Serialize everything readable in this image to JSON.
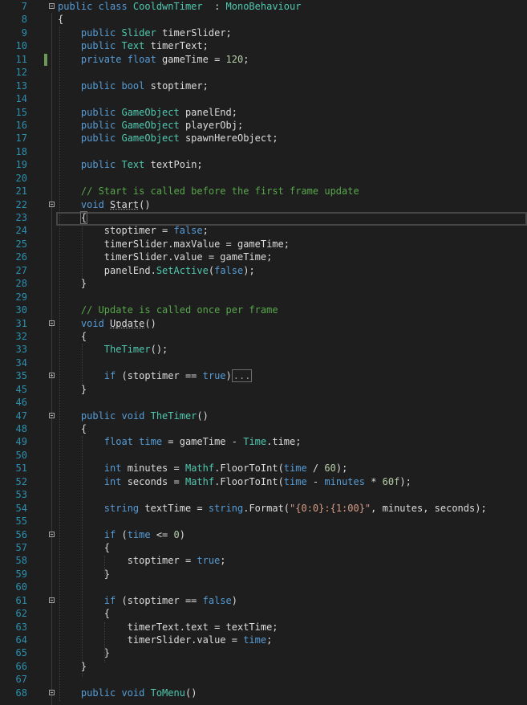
{
  "editor": {
    "fold_icon": "collapse-box-icon",
    "expand_icon": "expand-box-icon",
    "lines": [
      {
        "n": "7",
        "fold": "minus",
        "tokens": [
          [
            "kw",
            "public class "
          ],
          [
            "ty",
            "CooldwnTimer"
          ],
          [
            "",
            "  : "
          ],
          [
            "ty",
            "MonoBehaviour"
          ]
        ]
      },
      {
        "n": "8",
        "fold": "",
        "tokens": [
          [
            "",
            "{"
          ]
        ]
      },
      {
        "n": "9",
        "fold": "",
        "tokens": [
          [
            "",
            "    "
          ],
          [
            "kw",
            "public "
          ],
          [
            "ty",
            "Slider"
          ],
          [
            "",
            " timerSlider;"
          ]
        ]
      },
      {
        "n": "10",
        "fold": "",
        "tokens": [
          [
            "",
            "    "
          ],
          [
            "kw",
            "public "
          ],
          [
            "ty",
            "Text"
          ],
          [
            "",
            " timerText;"
          ]
        ]
      },
      {
        "n": "11",
        "fold": "",
        "tokens": [
          [
            "",
            "    "
          ],
          [
            "kw",
            "private float"
          ],
          [
            "",
            " gameTime = "
          ],
          [
            "nm",
            "120"
          ],
          [
            "",
            ";"
          ]
        ]
      },
      {
        "n": "12",
        "fold": "",
        "tokens": []
      },
      {
        "n": "13",
        "fold": "",
        "tokens": [
          [
            "",
            "    "
          ],
          [
            "kw",
            "public bool"
          ],
          [
            "",
            " stoptimer;"
          ]
        ]
      },
      {
        "n": "14",
        "fold": "",
        "tokens": []
      },
      {
        "n": "15",
        "fold": "",
        "tokens": [
          [
            "",
            "    "
          ],
          [
            "kw",
            "public "
          ],
          [
            "ty",
            "GameObject"
          ],
          [
            "",
            " panelEnd;"
          ]
        ]
      },
      {
        "n": "16",
        "fold": "",
        "tokens": [
          [
            "",
            "    "
          ],
          [
            "kw",
            "public "
          ],
          [
            "ty",
            "GameObject"
          ],
          [
            "",
            " playerObj;"
          ]
        ]
      },
      {
        "n": "17",
        "fold": "",
        "tokens": [
          [
            "",
            "    "
          ],
          [
            "kw",
            "public "
          ],
          [
            "ty",
            "GameObject"
          ],
          [
            "",
            " spawnHereObject;"
          ]
        ]
      },
      {
        "n": "18",
        "fold": "",
        "tokens": []
      },
      {
        "n": "19",
        "fold": "",
        "tokens": [
          [
            "",
            "    "
          ],
          [
            "kw",
            "public "
          ],
          [
            "ty",
            "Text"
          ],
          [
            "",
            " textPoin;"
          ]
        ]
      },
      {
        "n": "20",
        "fold": "",
        "tokens": []
      },
      {
        "n": "21",
        "fold": "",
        "tokens": [
          [
            "",
            "    "
          ],
          [
            "cm",
            "// Start is called before the first frame update"
          ]
        ]
      },
      {
        "n": "22",
        "fold": "minus",
        "tokens": [
          [
            "",
            "    "
          ],
          [
            "kw",
            "void "
          ],
          [
            "squig",
            "Start"
          ],
          [
            "",
            "()"
          ]
        ]
      },
      {
        "n": "23",
        "fold": "",
        "tokens": [
          [
            "",
            "    "
          ],
          [
            "brace-hl",
            "{"
          ]
        ]
      },
      {
        "n": "24",
        "fold": "",
        "tokens": [
          [
            "",
            "        stoptimer = "
          ],
          [
            "kw",
            "false"
          ],
          [
            "",
            ";"
          ]
        ]
      },
      {
        "n": "25",
        "fold": "",
        "tokens": [
          [
            "",
            "        timerSlider.maxValue = gameTime;"
          ]
        ]
      },
      {
        "n": "26",
        "fold": "",
        "tokens": [
          [
            "",
            "        timerSlider.value = gameTime;"
          ]
        ]
      },
      {
        "n": "27",
        "fold": "",
        "tokens": [
          [
            "",
            "        panelEnd."
          ],
          [
            "ty",
            "SetActive"
          ],
          [
            "",
            "("
          ],
          [
            "kw",
            "false"
          ],
          [
            "",
            ");"
          ]
        ]
      },
      {
        "n": "28",
        "fold": "",
        "tokens": [
          [
            "",
            "    }"
          ]
        ]
      },
      {
        "n": "29",
        "fold": "",
        "tokens": []
      },
      {
        "n": "30",
        "fold": "",
        "tokens": [
          [
            "",
            "    "
          ],
          [
            "cm",
            "// Update is called once per frame"
          ]
        ]
      },
      {
        "n": "31",
        "fold": "minus",
        "tokens": [
          [
            "",
            "    "
          ],
          [
            "kw",
            "void "
          ],
          [
            "squig",
            "Update"
          ],
          [
            "",
            "()"
          ]
        ]
      },
      {
        "n": "32",
        "fold": "",
        "tokens": [
          [
            "",
            "    {"
          ]
        ]
      },
      {
        "n": "33",
        "fold": "",
        "tokens": [
          [
            "",
            "        "
          ],
          [
            "ty",
            "TheTimer"
          ],
          [
            "",
            "();"
          ]
        ]
      },
      {
        "n": "34",
        "fold": "",
        "tokens": []
      },
      {
        "n": "35",
        "fold": "plus",
        "tokens": [
          [
            "",
            "        "
          ],
          [
            "kw",
            "if"
          ],
          [
            "",
            " (stoptimer == "
          ],
          [
            "kw",
            "true"
          ],
          [
            "",
            ")"
          ],
          [
            "ellipsis",
            "..."
          ]
        ]
      },
      {
        "n": "45",
        "fold": "",
        "tokens": [
          [
            "",
            "    }"
          ]
        ]
      },
      {
        "n": "46",
        "fold": "",
        "tokens": []
      },
      {
        "n": "47",
        "fold": "minus",
        "tokens": [
          [
            "",
            "    "
          ],
          [
            "kw",
            "public void "
          ],
          [
            "ty",
            "TheTimer"
          ],
          [
            "",
            "()"
          ]
        ]
      },
      {
        "n": "48",
        "fold": "",
        "tokens": [
          [
            "",
            "    {"
          ]
        ]
      },
      {
        "n": "49",
        "fold": "",
        "tokens": [
          [
            "",
            "        "
          ],
          [
            "kw",
            "float"
          ],
          [
            "",
            " "
          ],
          [
            "kw",
            "time"
          ],
          [
            "",
            " = gameTime - "
          ],
          [
            "ty",
            "Time"
          ],
          [
            ".",
            ".time;"
          ]
        ]
      },
      {
        "n": "50",
        "fold": "",
        "tokens": []
      },
      {
        "n": "51",
        "fold": "",
        "tokens": [
          [
            "",
            "        "
          ],
          [
            "kw",
            "int"
          ],
          [
            "",
            " minutes = "
          ],
          [
            "ty",
            "Mathf"
          ],
          [
            "",
            ".FloorToInt("
          ],
          [
            "kw",
            "time"
          ],
          [
            "",
            " / "
          ],
          [
            "nm",
            "60"
          ],
          [
            "",
            ");"
          ]
        ]
      },
      {
        "n": "52",
        "fold": "",
        "tokens": [
          [
            "",
            "        "
          ],
          [
            "kw",
            "int"
          ],
          [
            "",
            " seconds = "
          ],
          [
            "ty",
            "Mathf"
          ],
          [
            "",
            ".FloorToInt("
          ],
          [
            "kw",
            "time"
          ],
          [
            "",
            " - "
          ],
          [
            "kw",
            "minutes"
          ],
          [
            "",
            " * "
          ],
          [
            "nm",
            "60f"
          ],
          [
            "",
            ");"
          ]
        ]
      },
      {
        "n": "53",
        "fold": "",
        "tokens": []
      },
      {
        "n": "54",
        "fold": "",
        "tokens": [
          [
            "",
            "        "
          ],
          [
            "kw",
            "string"
          ],
          [
            "",
            " textTime = "
          ],
          [
            "kw",
            "string"
          ],
          [
            "",
            ".Format("
          ],
          [
            "st",
            "\"{0:0}:{1:00}\""
          ],
          [
            "",
            ", minutes, seconds);"
          ]
        ]
      },
      {
        "n": "55",
        "fold": "",
        "tokens": []
      },
      {
        "n": "56",
        "fold": "minus",
        "tokens": [
          [
            "",
            "        "
          ],
          [
            "kw",
            "if"
          ],
          [
            "",
            " ("
          ],
          [
            "kw",
            "time"
          ],
          [
            "",
            " <= "
          ],
          [
            "nm",
            "0"
          ],
          [
            "",
            ")"
          ]
        ]
      },
      {
        "n": "57",
        "fold": "",
        "tokens": [
          [
            "",
            "        {"
          ]
        ]
      },
      {
        "n": "58",
        "fold": "",
        "tokens": [
          [
            "",
            "            stoptimer = "
          ],
          [
            "kw",
            "true"
          ],
          [
            "",
            ";"
          ]
        ]
      },
      {
        "n": "59",
        "fold": "",
        "tokens": [
          [
            "",
            "        }"
          ]
        ]
      },
      {
        "n": "60",
        "fold": "",
        "tokens": []
      },
      {
        "n": "61",
        "fold": "minus",
        "tokens": [
          [
            "",
            "        "
          ],
          [
            "kw",
            "if"
          ],
          [
            "",
            " (stoptimer == "
          ],
          [
            "kw",
            "false"
          ],
          [
            "",
            ")"
          ]
        ]
      },
      {
        "n": "62",
        "fold": "",
        "tokens": [
          [
            "",
            "        {"
          ]
        ]
      },
      {
        "n": "63",
        "fold": "",
        "tokens": [
          [
            "",
            "            timerText.text = textTime;"
          ]
        ]
      },
      {
        "n": "64",
        "fold": "",
        "tokens": [
          [
            "",
            "            timerSlider.value = "
          ],
          [
            "kw",
            "time"
          ],
          [
            "",
            ";"
          ]
        ]
      },
      {
        "n": "65",
        "fold": "",
        "tokens": [
          [
            "",
            "        }"
          ]
        ]
      },
      {
        "n": "66",
        "fold": "",
        "tokens": [
          [
            "",
            "    }"
          ]
        ]
      },
      {
        "n": "67",
        "fold": "",
        "tokens": []
      },
      {
        "n": "68",
        "fold": "minus",
        "tokens": [
          [
            "",
            "    "
          ],
          [
            "kw",
            "public void "
          ],
          [
            "ty",
            "ToMenu"
          ],
          [
            "",
            "()"
          ]
        ]
      }
    ]
  }
}
